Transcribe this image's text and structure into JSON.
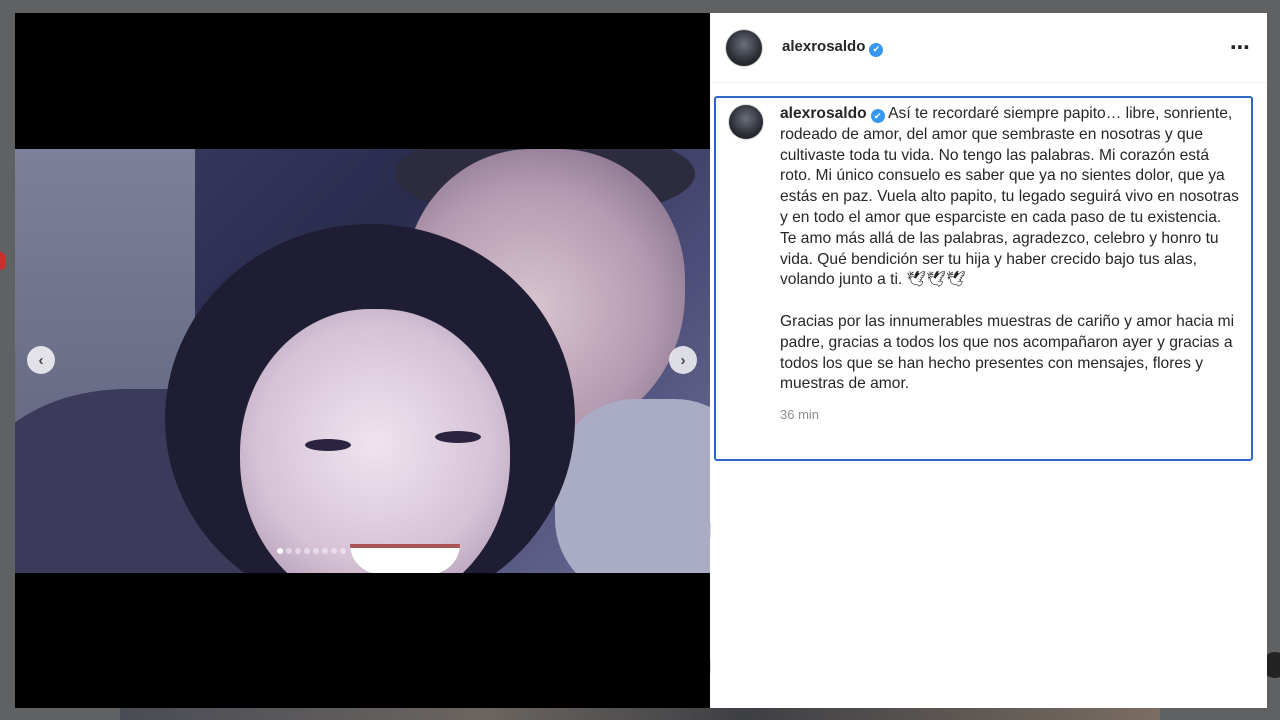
{
  "post": {
    "username": "alexrosaldo",
    "verified_mark": "✔",
    "more_icon": "⋯",
    "caption_p1": "Así te recordaré siempre papito… libre, sonriente, rodeado de amor, del amor que sembraste en nosotras y que cultivaste toda tu vida. No tengo las palabras. Mi corazón está roto. Mi único consuelo es saber que ya no sientes dolor, que ya estás en paz. Vuela alto papito, tu legado seguirá vivo en nosotras y en todo el amor que esparciste en cada paso de tu existencia. Te amo más allá de las palabras, agradezco, celebro y honro tu vida. Qué bendición ser tu hija y haber crecido bajo tus alas, volando junto a ti. 🕊🕊🕊",
    "caption_p2": "Gracias por las innumerables muestras de cariño y amor hacia mi padre, gracias a todos los que nos acompañaron ayer y gracias a todos los que se han hecho presentes con mensajes, flores y muestras de amor.",
    "time": "36 min"
  },
  "media": {
    "prev_icon": "‹",
    "next_icon": "›",
    "carousel_count": 8,
    "carousel_active": 0
  },
  "colors": {
    "accent_border": "#2f64c8",
    "verified_blue": "#3897f0"
  }
}
